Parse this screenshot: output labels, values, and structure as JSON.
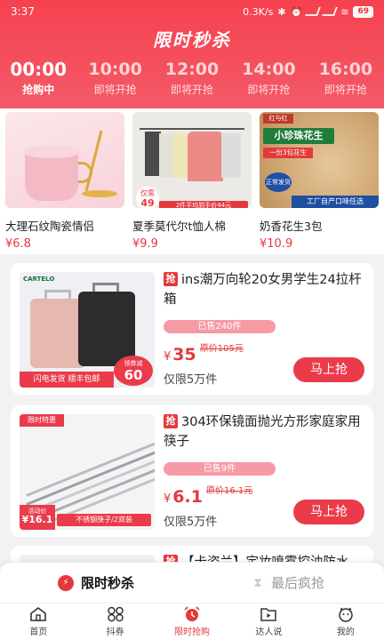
{
  "status_bar": {
    "time": "3:37",
    "speed": "0.3K/s",
    "battery": "69"
  },
  "header": {
    "title": "限时秒杀",
    "slots": [
      {
        "time": "00:00",
        "status": "抢购中",
        "active": true
      },
      {
        "time": "10:00",
        "status": "即将开抢",
        "active": false
      },
      {
        "time": "12:00",
        "status": "即将开抢",
        "active": false
      },
      {
        "time": "14:00",
        "status": "即将开抢",
        "active": false
      },
      {
        "time": "16:00",
        "status": "即将开抢",
        "active": false
      }
    ]
  },
  "featured": [
    {
      "name": "大理石纹陶瓷情侣",
      "price": "¥6.8",
      "image_icon": "mug-image"
    },
    {
      "name": "夏季莫代尔t恤人棉",
      "price": "¥9.9",
      "image_icon": "tshirt-image",
      "badge_top": "仅需",
      "badge_num": "49",
      "badge_caption": "2件平均到手价44元"
    },
    {
      "name": "奶香花生3包",
      "price": "¥10.9",
      "image_icon": "peanut-image",
      "brand": "红与红",
      "banner": "小珍珠花生",
      "promo": "一份3包花生",
      "tag": "正常发货",
      "strip": "工厂自产口味任选"
    }
  ],
  "deals": [
    {
      "badge": "抢",
      "title": "ins潮万向轮20女男学生24拉杆箱",
      "sold": "已售240件",
      "currency": "¥",
      "price": "35",
      "original_price": "原价105元",
      "limit": "仅限5万件",
      "button": "马上抢",
      "image_icon": "suitcase-image",
      "image_brand": "CARTELO",
      "image_shipping": "闪电发货 顺丰包邮",
      "image_coupon_label": "领券减",
      "image_coupon_value": "60"
    },
    {
      "badge": "抢",
      "title": "304环保镜面抛光方形家庭家用筷子",
      "sold": "已售9件",
      "currency": "¥",
      "price": "6.1",
      "original_price": "原价16.1元",
      "limit": "仅限5万件",
      "button": "马上抢",
      "image_icon": "chopsticks-image",
      "image_corner": "限时特惠",
      "image_price_label": "活动价",
      "image_price": "¥16.1",
      "image_caption": "不锈钢筷子/2双装"
    },
    {
      "badge": "抢",
      "title": "【卡姿兰】定妆喷雾控油防水"
    }
  ],
  "sub_tabs": [
    {
      "label": "限时秒杀",
      "active": true,
      "icon": "flash-icon"
    },
    {
      "label": "最后疯抢",
      "active": false,
      "icon": "hourglass-icon"
    }
  ],
  "bottom_nav": [
    {
      "label": "首页",
      "icon": "home-icon",
      "active": false
    },
    {
      "label": "抖券",
      "icon": "coupon-grid-icon",
      "active": false
    },
    {
      "label": "限时抢购",
      "icon": "alarm-clock-icon",
      "active": true
    },
    {
      "label": "达人说",
      "icon": "folder-play-icon",
      "active": false
    },
    {
      "label": "我的",
      "icon": "profile-icon",
      "active": false
    }
  ],
  "colors": {
    "accent": "#e4393c",
    "header_top": "#f6414f",
    "header_bottom": "#f35a68",
    "sold_bar": "#f69aa5"
  }
}
